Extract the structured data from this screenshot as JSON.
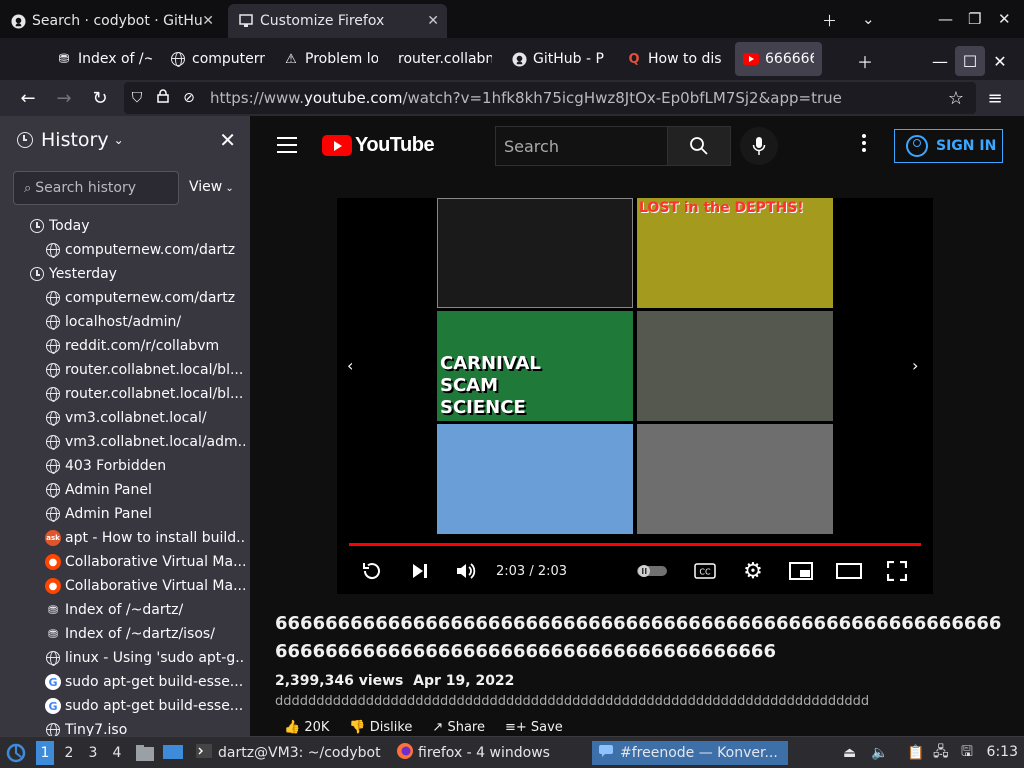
{
  "outer_window": {
    "tabs": [
      {
        "label": "Search · codybot · GitHu",
        "icon": "github-icon"
      },
      {
        "label": "Customize Firefox",
        "icon": "window-icon"
      }
    ]
  },
  "browser": {
    "tabs": [
      {
        "label": "Index of /~",
        "icon": "index-icon"
      },
      {
        "label": "computern",
        "icon": "globe-icon"
      },
      {
        "label": "Problem lo",
        "icon": "warning-icon"
      },
      {
        "label": "router.collabn",
        "icon": "none"
      },
      {
        "label": "GitHub - P",
        "icon": "github-icon"
      },
      {
        "label": "How to dis",
        "icon": "quora-icon"
      },
      {
        "label": "6666666",
        "icon": "youtube-icon"
      }
    ],
    "url_host": "https://www.",
    "url_domain": "youtube.com",
    "url_rest": "/watch?v=1hfk8kh75icgHwz8JtOx-Ep0bfLM7Sj2&app=true"
  },
  "sidebar": {
    "title": "History",
    "search_placeholder": "Search history",
    "view_label": "View",
    "groups": [
      {
        "label": "Today",
        "items": [
          {
            "label": "computernew.com/dartz",
            "icon": "globe"
          }
        ]
      },
      {
        "label": "Yesterday",
        "items": [
          {
            "label": "computernew.com/dartz",
            "icon": "globe"
          },
          {
            "label": "localhost/admin/",
            "icon": "globe"
          },
          {
            "label": "reddit.com/r/collabvm",
            "icon": "globe"
          },
          {
            "label": "router.collabnet.local/bl...",
            "icon": "globe"
          },
          {
            "label": "router.collabnet.local/bl...",
            "icon": "globe"
          },
          {
            "label": "vm3.collabnet.local/",
            "icon": "globe"
          },
          {
            "label": "vm3.collabnet.local/adm...",
            "icon": "globe"
          },
          {
            "label": "403 Forbidden",
            "icon": "globe"
          },
          {
            "label": "Admin Panel",
            "icon": "globe"
          },
          {
            "label": "Admin Panel",
            "icon": "globe"
          },
          {
            "label": "apt - How to install build...",
            "icon": "askubuntu"
          },
          {
            "label": "Collaborative Virtual Ma...",
            "icon": "reddit"
          },
          {
            "label": "Collaborative Virtual Ma...",
            "icon": "reddit"
          },
          {
            "label": "Index of /~dartz/",
            "icon": "index"
          },
          {
            "label": "Index of /~dartz/isos/",
            "icon": "index"
          },
          {
            "label": "linux - Using 'sudo apt-g...",
            "icon": "globe"
          },
          {
            "label": "sudo apt-get build-esse...",
            "icon": "google"
          },
          {
            "label": "sudo apt-get build-esse...",
            "icon": "google"
          },
          {
            "label": "Tiny7.iso",
            "icon": "globe"
          }
        ]
      }
    ]
  },
  "youtube": {
    "logo_text": "YouTube",
    "search_placeholder": "Search",
    "sign_in": "SIGN IN",
    "player": {
      "time": "2:03 / 2:03",
      "progress": 1.0,
      "thumbnails": [
        {
          "text": "",
          "bg": "#1a1a1a"
        },
        {
          "text": "LOST in the DEPTHS!",
          "bg": "#a39a1e"
        },
        {
          "text": "CARNIVAL SCAM SCIENCE",
          "bg": "#1f7a3a"
        },
        {
          "text": "",
          "bg": "#55584f"
        },
        {
          "text": "",
          "bg": "#6a9ed6"
        },
        {
          "text": "",
          "bg": "#6e6e6e"
        }
      ]
    },
    "title": "66666666666666666666666666666666666666666666666666666666666666666666666666666666666666666666666666",
    "views": "2,399,346 views",
    "date": "Apr 19, 2022",
    "description": "dddddddddddddddddddddddddddddddddddddddddddddddddddddddddddddddddddddddd",
    "actions": [
      "20K",
      "Dislike",
      "Share",
      "Save"
    ]
  },
  "taskbar": {
    "workspaces": [
      "1",
      "2",
      "3",
      "4"
    ],
    "tasks": [
      {
        "label": "dartz@VM3: ~/codybot"
      },
      {
        "label": "firefox - 4 windows"
      },
      {
        "label": "#freenode — Konver..."
      }
    ],
    "clock": "6:13"
  },
  "colors": {
    "accent": "#3ea6ff",
    "youtube_red": "#ff0000",
    "sidebar_bg": "#38373f"
  }
}
